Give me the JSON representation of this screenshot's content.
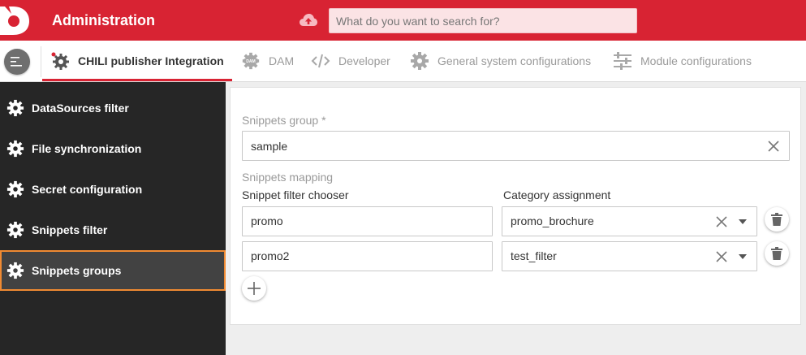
{
  "header": {
    "title": "Administration",
    "search_placeholder": "What do you want to search for?",
    "search_value": "",
    "brand_color": "#d82333",
    "icons": {
      "logo": "chili-logo-icon",
      "upload": "cloud-upload-icon"
    }
  },
  "tabs": [
    {
      "label": "CHILI publisher Integration",
      "icon": "chili-gear-icon",
      "active": true
    },
    {
      "label": "DAM",
      "icon": "dam-gear-icon",
      "active": false
    },
    {
      "label": "Developer",
      "icon": "code-icon",
      "active": false
    },
    {
      "label": "General system configurations",
      "icon": "gear-icon",
      "active": false
    },
    {
      "label": "Module configurations",
      "icon": "sliders-icon",
      "active": false
    }
  ],
  "sidebar": {
    "items": [
      {
        "label": "DataSources filter",
        "active": false
      },
      {
        "label": "File synchronization",
        "active": false
      },
      {
        "label": "Secret configuration",
        "active": false
      },
      {
        "label": "Snippets filter",
        "active": false
      },
      {
        "label": "Snippets groups",
        "active": true
      }
    ],
    "active_outline_color": "#f08a32"
  },
  "form": {
    "group_label": "Snippets group *",
    "group_value": "sample",
    "mapping_label": "Snippets mapping",
    "col_filter": "Snippet filter chooser",
    "col_category": "Category assignment",
    "rows": [
      {
        "filter": "promo",
        "category": "promo_brochure"
      },
      {
        "filter": "promo2",
        "category": "test_filter"
      }
    ]
  }
}
